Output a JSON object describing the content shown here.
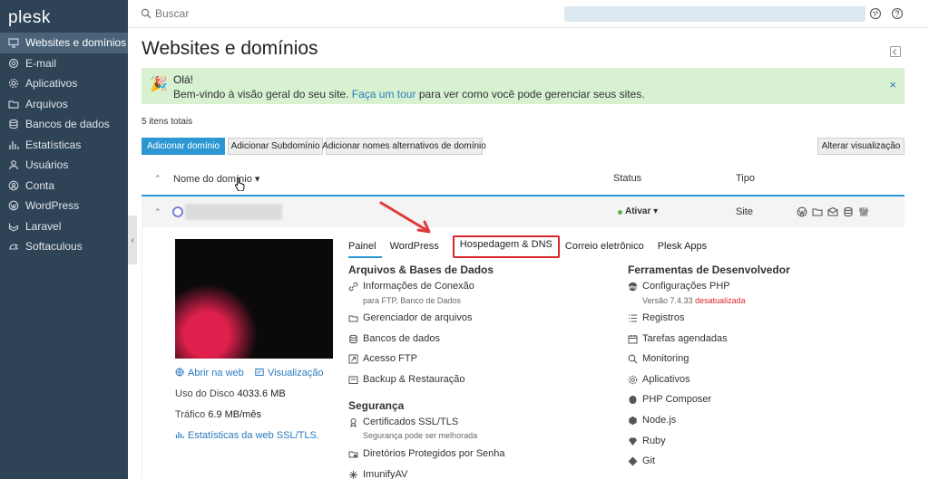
{
  "app": {
    "logo": "plesk"
  },
  "sidebar": {
    "items": [
      {
        "label": "Websites e domínios",
        "icon": "monitor-icon",
        "active": true
      },
      {
        "label": "E-mail",
        "icon": "mail-icon"
      },
      {
        "label": "Aplicativos",
        "icon": "gear-icon"
      },
      {
        "label": "Arquivos",
        "icon": "folder-icon"
      },
      {
        "label": "Bancos de dados",
        "icon": "database-icon"
      },
      {
        "label": "Estatísticas",
        "icon": "bar-chart-icon"
      },
      {
        "label": "Usuários",
        "icon": "user-icon"
      },
      {
        "label": "Conta",
        "icon": "account-icon"
      },
      {
        "label": "WordPress",
        "icon": "wordpress-icon"
      },
      {
        "label": "Laravel",
        "icon": "laravel-icon"
      },
      {
        "label": "Softaculous",
        "icon": "softaculous-icon"
      }
    ]
  },
  "topbar": {
    "search_placeholder": "Buscar"
  },
  "page": {
    "title": "Websites e domínios"
  },
  "welcome": {
    "title": "Olá!",
    "text_before": "Bem-vindo à visão geral do seu site.",
    "link": "Faça um tour",
    "text_after": "para ver como você pode gerenciar seus sites.",
    "close": "×"
  },
  "list": {
    "count": "5 itens totais",
    "buttons": {
      "add_domain": "Adicionar domínio",
      "add_subdomain": "Adicionar Subdomínio",
      "add_alias": "Adicionar nomes alternativos de domínio",
      "change_view": "Alterar visualização"
    },
    "headers": {
      "name": "Nome do domínio",
      "status": "Status",
      "type": "Tipo"
    },
    "row": {
      "status": "Ativar",
      "type": "Site"
    }
  },
  "detail": {
    "open_web": "Abrir na web",
    "preview": "Visualização",
    "disk_label": "Uso do Disco",
    "disk_value": "4033.6 MB",
    "traffic_label": "Tráfico",
    "traffic_value": "6.9 MB/mês",
    "ssl_stats": "Estatísticas da web SSL/TLS.",
    "tabs": [
      "Painel",
      "WordPress",
      "Hospedagem & DNS",
      "Correio eletrônico",
      "Plesk Apps"
    ],
    "col1": {
      "title": "Arquivos & Bases de Dados",
      "items": [
        {
          "label": "Informações de Conexão",
          "sub": "para FTP, Banco de Dados",
          "icon": "connection-icon"
        },
        {
          "label": "Gerenciador de arquivos",
          "icon": "folder-icon"
        },
        {
          "label": "Bancos de dados",
          "icon": "database-icon"
        },
        {
          "label": "Acesso FTP",
          "icon": "ftp-icon"
        },
        {
          "label": "Backup & Restauração",
          "icon": "backup-icon"
        }
      ],
      "security_title": "Segurança",
      "security_items": [
        {
          "label": "Certificados SSL/TLS",
          "sub": "Segurança pode ser melhorada",
          "icon": "certificate-icon"
        },
        {
          "label": "Diretórios Protegidos por Senha",
          "icon": "protected-folder-icon"
        },
        {
          "label": "ImunifyAV",
          "icon": "imunify-icon"
        }
      ]
    },
    "col2": {
      "title": "Ferramentas de Desenvolvedor",
      "php_label": "Configurações PHP",
      "php_version": "Versão 7.4.33",
      "php_outdated": "desatualizada",
      "items": [
        {
          "label": "Registros",
          "icon": "logs-icon"
        },
        {
          "label": "Tarefas agendadas",
          "icon": "calendar-icon"
        },
        {
          "label": "Monitoring",
          "icon": "monitoring-icon"
        },
        {
          "label": "Aplicativos",
          "icon": "gear-icon"
        },
        {
          "label": "PHP Composer",
          "icon": "composer-icon"
        },
        {
          "label": "Node.js",
          "icon": "nodejs-icon"
        },
        {
          "label": "Ruby",
          "icon": "ruby-icon"
        },
        {
          "label": "Git",
          "icon": "git-icon"
        }
      ]
    }
  },
  "colors": {
    "sidebar_bg": "#2f4356",
    "accent": "#2d97d3",
    "highlight": "#d9262b",
    "welcome_bg": "#d7f1d1"
  }
}
